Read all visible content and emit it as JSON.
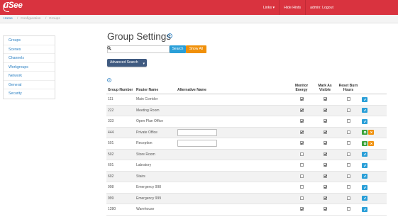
{
  "app": {
    "logo_text": "uSee",
    "nav": [
      {
        "label": "Links ▾"
      },
      {
        "label": "Hide Hints"
      },
      {
        "label": "admin: Logout"
      }
    ]
  },
  "breadcrumb": {
    "home": "Home",
    "sep1": "/",
    "configuration": "Configuration",
    "sep2": "/",
    "current": "Groups"
  },
  "sidebar": {
    "items": [
      {
        "label": "Groups"
      },
      {
        "label": "Scenes"
      },
      {
        "label": "Channels"
      },
      {
        "label": "Workgroups"
      },
      {
        "label": "Network"
      },
      {
        "label": "General"
      },
      {
        "label": "Security"
      }
    ]
  },
  "page": {
    "title": "Group Settings",
    "search_placeholder": "",
    "search_label": "Search",
    "show_all_label": "Show All",
    "advanced_search_label": "Advanced Search"
  },
  "table": {
    "headers": {
      "group_number": "Group Number",
      "router_name": "Router Name",
      "alternative_name": "Alternative Name",
      "monitor_energy": "Monitor Energy",
      "mark_as_visible": "Mark As Visible",
      "reset_burn_hours": "Reset Burn Hours"
    },
    "rows": [
      {
        "group": "111",
        "router": "Main Corridor",
        "editing": false,
        "monitor": true,
        "visible": true,
        "reset": false
      },
      {
        "group": "222",
        "router": "Meeting Room",
        "editing": false,
        "monitor": true,
        "visible": true,
        "reset": false
      },
      {
        "group": "333",
        "router": "Open Plan Office",
        "editing": false,
        "monitor": true,
        "visible": true,
        "reset": false
      },
      {
        "group": "444",
        "router": "Private Office",
        "editing": true,
        "monitor": true,
        "visible": true,
        "reset": false
      },
      {
        "group": "501",
        "router": "Reception",
        "editing": true,
        "monitor": true,
        "visible": true,
        "reset": false
      },
      {
        "group": "502",
        "router": "Store Room",
        "editing": false,
        "monitor": false,
        "visible": true,
        "reset": false
      },
      {
        "group": "601",
        "router": "Labratory",
        "editing": false,
        "monitor": false,
        "visible": true,
        "reset": false
      },
      {
        "group": "602",
        "router": "Stairs",
        "editing": false,
        "monitor": false,
        "visible": true,
        "reset": false
      },
      {
        "group": "998",
        "router": "Emergency 998",
        "editing": false,
        "monitor": false,
        "visible": true,
        "reset": false
      },
      {
        "group": "999",
        "router": "Emergency 999",
        "editing": false,
        "monitor": false,
        "visible": true,
        "reset": false
      },
      {
        "group": "1280",
        "router": "Warehouse",
        "editing": false,
        "monitor": true,
        "visible": true,
        "reset": false
      }
    ]
  },
  "colors": {
    "topbar": "#d9333f",
    "link": "#2a7fc2",
    "search_button": "#2a9fd8",
    "show_all_button": "#f0900a",
    "advanced_button": "#3f5a80",
    "edit_button": "#2a9fd8",
    "save_button": "#3aa33a",
    "cancel_button": "#f0900a"
  },
  "icons": {
    "title_help": "question-circle-icon",
    "table_help": "question-circle-icon",
    "search": "search-icon",
    "edit": "pencil-icon",
    "save": "gear-icon",
    "cancel": "close-icon"
  }
}
